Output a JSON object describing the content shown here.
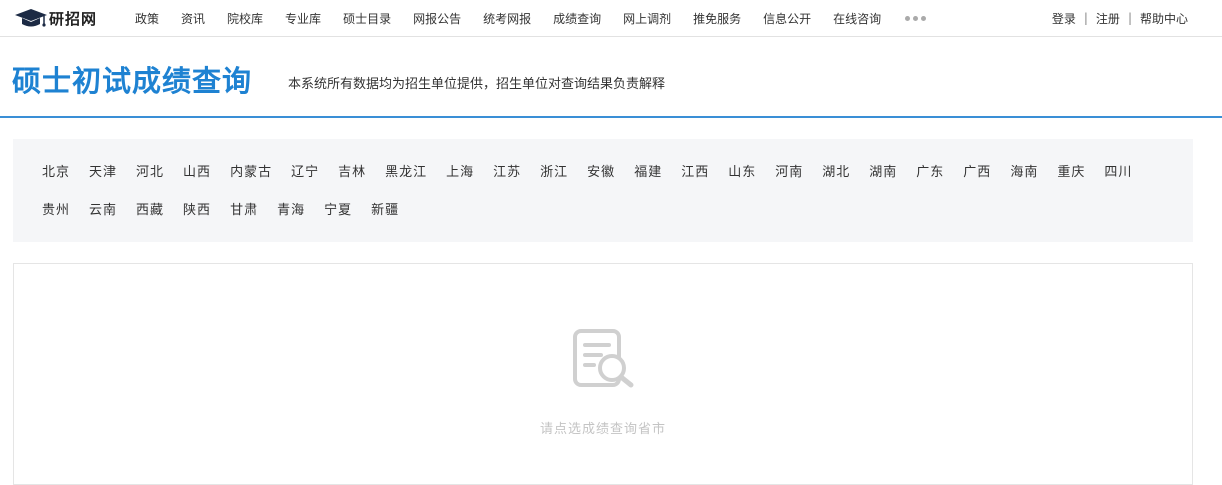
{
  "brand": {
    "name": "研招网"
  },
  "nav": {
    "items": [
      "政策",
      "资讯",
      "院校库",
      "专业库",
      "硕士目录",
      "网报公告",
      "统考网报",
      "成绩查询",
      "网上调剂",
      "推免服务",
      "信息公开",
      "在线咨询"
    ],
    "more_icon": "more-dots-icon"
  },
  "user_links": {
    "login": "登录",
    "register": "注册",
    "help": "帮助中心",
    "separator": "|"
  },
  "page": {
    "title": "硕士初试成绩查询",
    "subtitle": "本系统所有数据均为招生单位提供，招生单位对查询结果负责解释"
  },
  "provinces": {
    "row1": [
      "北京",
      "天津",
      "河北",
      "山西",
      "内蒙古",
      "辽宁",
      "吉林",
      "黑龙江",
      "上海",
      "江苏",
      "浙江",
      "安徽",
      "福建",
      "江西",
      "山东",
      "河南",
      "湖北",
      "湖南",
      "广东",
      "广西",
      "海南",
      "重庆",
      "四川"
    ],
    "row2": [
      "贵州",
      "云南",
      "西藏",
      "陕西",
      "甘肃",
      "青海",
      "宁夏",
      "新疆"
    ]
  },
  "result": {
    "empty_icon": "document-search-icon",
    "empty_message": "请点选成绩查询省市"
  },
  "colors": {
    "accent": "#1e82d2",
    "divider": "#3a8fd6",
    "panel_bg": "#f5f6f8",
    "muted_text": "#c4c4c4"
  }
}
